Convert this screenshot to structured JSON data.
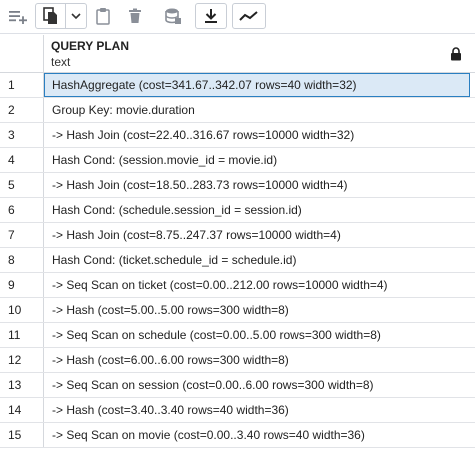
{
  "toolbar": {
    "buttons": [
      {
        "name": "add-row-icon"
      },
      {
        "name": "copy-icon"
      },
      {
        "name": "chevron-down-icon"
      },
      {
        "name": "paste-icon"
      },
      {
        "name": "delete-icon"
      },
      {
        "name": "save-data-icon"
      },
      {
        "name": "download-icon"
      },
      {
        "name": "graph-icon"
      }
    ]
  },
  "grid": {
    "column": {
      "name": "QUERY PLAN",
      "type": "text"
    },
    "rows": [
      {
        "n": "1",
        "text": "HashAggregate (cost=341.67..342.07 rows=40 width=32)"
      },
      {
        "n": "2",
        "text": "Group Key: movie.duration"
      },
      {
        "n": "3",
        "text": "-> Hash Join (cost=22.40..316.67 rows=10000 width=32)"
      },
      {
        "n": "4",
        "text": "Hash Cond: (session.movie_id = movie.id)"
      },
      {
        "n": "5",
        "text": "-> Hash Join (cost=18.50..283.73 rows=10000 width=4)"
      },
      {
        "n": "6",
        "text": "Hash Cond: (schedule.session_id = session.id)"
      },
      {
        "n": "7",
        "text": "-> Hash Join (cost=8.75..247.37 rows=10000 width=4)"
      },
      {
        "n": "8",
        "text": "Hash Cond: (ticket.schedule_id = schedule.id)"
      },
      {
        "n": "9",
        "text": "-> Seq Scan on ticket (cost=0.00..212.00 rows=10000 width=4)"
      },
      {
        "n": "10",
        "text": "-> Hash (cost=5.00..5.00 rows=300 width=8)"
      },
      {
        "n": "11",
        "text": "-> Seq Scan on schedule (cost=0.00..5.00 rows=300 width=8)"
      },
      {
        "n": "12",
        "text": "-> Hash (cost=6.00..6.00 rows=300 width=8)"
      },
      {
        "n": "13",
        "text": "-> Seq Scan on session (cost=0.00..6.00 rows=300 width=8)"
      },
      {
        "n": "14",
        "text": "-> Hash (cost=3.40..3.40 rows=40 width=36)"
      },
      {
        "n": "15",
        "text": "-> Seq Scan on movie (cost=0.00..3.40 rows=40 width=36)"
      }
    ]
  },
  "colors": {
    "selected_bg": "#dbe9f6",
    "selected_border": "#2a7fc1"
  }
}
